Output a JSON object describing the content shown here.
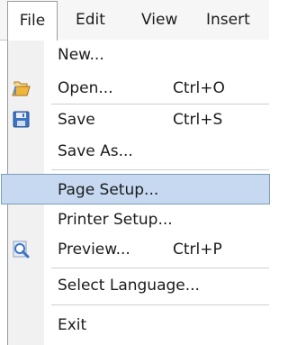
{
  "menubar": {
    "items": [
      {
        "label": "File"
      },
      {
        "label": "Edit"
      },
      {
        "label": "View"
      },
      {
        "label": "Insert"
      }
    ]
  },
  "file_menu": {
    "items": [
      {
        "label": "New...",
        "shortcut": ""
      },
      {
        "label": "Open...",
        "shortcut": "Ctrl+O",
        "icon": "open-folder-icon"
      },
      {
        "label": "Save",
        "shortcut": "Ctrl+S",
        "icon": "save-disk-icon"
      },
      {
        "label": "Save As...",
        "shortcut": ""
      },
      {
        "label": "Page Setup...",
        "shortcut": "",
        "selected": true
      },
      {
        "label": "Printer Setup...",
        "shortcut": ""
      },
      {
        "label": "Preview...",
        "shortcut": "Ctrl+P",
        "icon": "preview-magnifier-icon"
      },
      {
        "label": "Select Language...",
        "shortcut": ""
      },
      {
        "label": "Exit",
        "shortcut": ""
      }
    ]
  },
  "colors": {
    "selection_fill": "#c6d9f1",
    "selection_border": "#7f9db9",
    "menubar_background": "#f6f6f6",
    "gutter_background": "#f1f1f1"
  }
}
